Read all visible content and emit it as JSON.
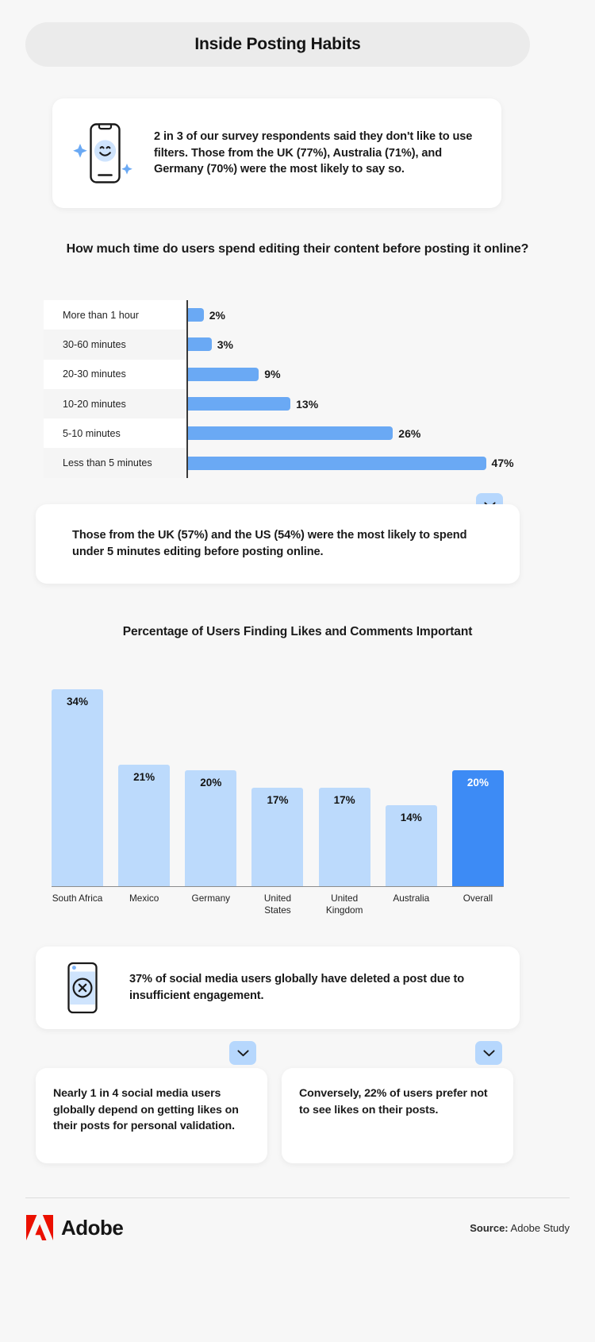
{
  "header": {
    "title": "Inside Posting Habits"
  },
  "card_filters": {
    "icon": "phone-smiley-icon",
    "text": "2 in 3 of our survey respondents said they don't like to use filters. Those from the UK (77%), Australia (71%), and Germany (70%) were the most likely to say so."
  },
  "card_uk_us": {
    "text": "Those from the UK (57%) and the US (54%) were the most likely to spend under 5 minutes editing before posting online.",
    "chevron_icon": "chevron-down-icon"
  },
  "card_deleted": {
    "icon": "deleted-post-icon",
    "text": "37% of social media users globally have deleted a post due to insufficient engagement."
  },
  "card_validation": {
    "text": "Nearly 1 in 4 social media users globally depend on getting likes on their posts for personal validation.",
    "chevron_icon": "chevron-down-icon"
  },
  "card_conversely": {
    "text": "Conversely, 22% of users prefer not to see likes on their posts.",
    "chevron_icon": "chevron-down-icon"
  },
  "footer": {
    "brand": "Adobe",
    "logo_icon": "adobe-logo-icon",
    "source_label": "Source:",
    "source_value": "Adobe Study"
  },
  "colors": {
    "page_background": "#f7f7f7",
    "banner": "#ebebeb",
    "bar_blue": "#6aa9f4",
    "column_light": "#bcdafc",
    "column_highlight": "#3d8bf5",
    "chevron_button": "#b6d7fd",
    "adobe_red": "#eb1000"
  },
  "chart_data": [
    {
      "type": "bar",
      "orientation": "horizontal",
      "title": "How much time do users spend editing their content before posting it online?",
      "xlabel": "",
      "ylabel": "",
      "categories": [
        "More than 1 hour",
        "30-60 minutes",
        "20-30 minutes",
        "10-20 minutes",
        "5-10 minutes",
        "Less than 5 minutes"
      ],
      "values": [
        2,
        3,
        9,
        13,
        26,
        47
      ],
      "value_labels": [
        "2%",
        "3%",
        "9%",
        "13%",
        "26%",
        "47%"
      ],
      "xlim": [
        0,
        50
      ],
      "grid": false,
      "legend": "none",
      "bar_color": "#6aa9f4"
    },
    {
      "type": "bar",
      "orientation": "vertical",
      "title": "Percentage of Users Finding Likes and Comments Important",
      "xlabel": "",
      "ylabel": "",
      "categories": [
        "South Africa",
        "Mexico",
        "Germany",
        "United States",
        "United Kingdom",
        "Australia",
        "Overall"
      ],
      "values": [
        34,
        21,
        20,
        17,
        17,
        14,
        20
      ],
      "value_labels": [
        "34%",
        "21%",
        "20%",
        "17%",
        "17%",
        "14%",
        "20%"
      ],
      "ylim": [
        0,
        36
      ],
      "grid": false,
      "legend": "none",
      "bar_color": "#bcdafc",
      "highlight_index": 6,
      "highlight_color": "#3d8bf5"
    }
  ]
}
